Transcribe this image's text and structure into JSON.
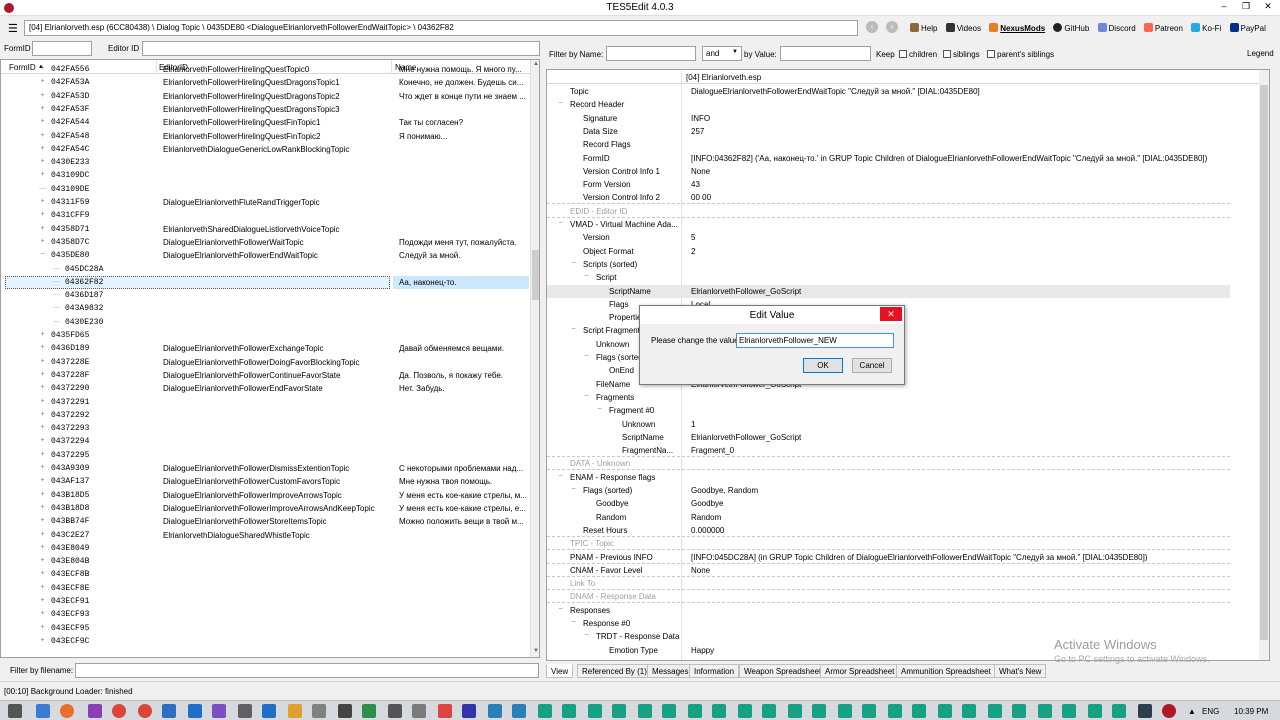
{
  "window": {
    "title": "TES5Edit 4.0.3",
    "minimize": "–",
    "maximize": "❐",
    "close": "✕"
  },
  "toolbar": {
    "path": "[04] Elrianlorveth.esp (6CC80438) \\ Dialog Topic \\ 0435DE80 <DialogueElrianlorvethFollowerEndWaitTopic> \\ 04362F82",
    "links": [
      "Help",
      "Videos",
      "NexusMods",
      "GitHub",
      "Discord",
      "Patreon",
      "Ko-Fi",
      "PayPal"
    ]
  },
  "left_filter": {
    "formid_label": "FormID",
    "editorid_label": "Editor ID"
  },
  "tree": {
    "columns": [
      "FormID",
      "EditorID",
      "Name"
    ],
    "rows": [
      {
        "fid": "042FA556",
        "eid": "ElrianlorvethFollowerHirelingQuestTopic0",
        "name": "Мне нужна помощь. Я много пу...",
        "level": 1,
        "exp": "+"
      },
      {
        "fid": "042FA53A",
        "eid": "ElrianlorvethFollowerHirelingQuestDragonsTopic1",
        "name": "Конечно, не должен. Будешь си...",
        "level": 1,
        "exp": "+"
      },
      {
        "fid": "042FA53D",
        "eid": "ElrianlorvethFollowerHirelingQuestDragonsTopic2",
        "name": "Что ждет в конце пути не знаем ...",
        "level": 1,
        "exp": "+"
      },
      {
        "fid": "042FA53F",
        "eid": "ElrianlorvethFollowerHirelingQuestDragonsTopic3",
        "name": "",
        "level": 1,
        "exp": "+"
      },
      {
        "fid": "042FA544",
        "eid": "ElrianlorvethFollowerHirelingQuestFinTopic1",
        "name": "Так ты согласен?",
        "level": 1,
        "exp": "+"
      },
      {
        "fid": "042FA548",
        "eid": "ElrianlorvethFollowerHirelingQuestFinTopic2",
        "name": "Я понимаю...",
        "level": 1,
        "exp": "+"
      },
      {
        "fid": "042FA54C",
        "eid": "ElrianlorvethDialogueGenericLowRankBlockingTopic",
        "name": "",
        "level": 1,
        "exp": "+"
      },
      {
        "fid": "0430E233",
        "eid": "",
        "name": "",
        "level": 1,
        "exp": "+"
      },
      {
        "fid": "043109DC",
        "eid": "",
        "name": "",
        "level": 1,
        "exp": "+"
      },
      {
        "fid": "043109DE",
        "eid": "",
        "name": "",
        "level": 1,
        "exp": ""
      },
      {
        "fid": "04311F59",
        "eid": "DialogueElrianlorvethFluteRandTriggerTopic",
        "name": "",
        "level": 1,
        "exp": "+"
      },
      {
        "fid": "0431CFF9",
        "eid": "",
        "name": "",
        "level": 1,
        "exp": "+"
      },
      {
        "fid": "04358D71",
        "eid": "ElrianlorvethSharedDialogueListlorvethVoiceTopic",
        "name": "",
        "level": 1,
        "exp": "+"
      },
      {
        "fid": "04358D7C",
        "eid": "DialogueElrianlorvethFollowerWaitTopic",
        "name": "Подожди меня тут, пожалуйста.",
        "level": 1,
        "exp": "+"
      },
      {
        "fid": "0435DE80",
        "eid": "DialogueElrianlorvethFollowerEndWaitTopic",
        "name": "Следуй за мной.",
        "level": 1,
        "exp": "−"
      },
      {
        "fid": "045DC28A",
        "eid": "",
        "name": "",
        "level": 2,
        "exp": ""
      },
      {
        "fid": "04362F82",
        "eid": "",
        "name": "Аа, наконец-то.",
        "level": 2,
        "exp": "",
        "selected": true
      },
      {
        "fid": "0436D187",
        "eid": "",
        "name": "",
        "level": 2,
        "exp": ""
      },
      {
        "fid": "043A9832",
        "eid": "",
        "name": "",
        "level": 2,
        "exp": ""
      },
      {
        "fid": "0430E230",
        "eid": "",
        "name": "",
        "level": 2,
        "exp": ""
      },
      {
        "fid": "0435FD65",
        "eid": "",
        "name": "",
        "level": 1,
        "exp": "+"
      },
      {
        "fid": "0436D189",
        "eid": "DialogueElrianlorvethFollowerExchangeTopic",
        "name": "Давай обменяемся вещами.",
        "level": 1,
        "exp": "+"
      },
      {
        "fid": "0437228E",
        "eid": "DialogueElrianlorvethFollowerDoingFavorBlockingTopic",
        "name": "",
        "level": 1,
        "exp": "+"
      },
      {
        "fid": "0437228F",
        "eid": "DialogueElrianlorvethFollowerContinueFavorState",
        "name": "Да. Позволь, я покажу тебе.",
        "level": 1,
        "exp": "+"
      },
      {
        "fid": "04372290",
        "eid": "DialogueElrianlorvethFollowerEndFavorState",
        "name": "Нет. Забудь.",
        "level": 1,
        "exp": "+"
      },
      {
        "fid": "04372291",
        "eid": "",
        "name": "",
        "level": 1,
        "exp": "+"
      },
      {
        "fid": "04372292",
        "eid": "",
        "name": "",
        "level": 1,
        "exp": "+"
      },
      {
        "fid": "04372293",
        "eid": "",
        "name": "",
        "level": 1,
        "exp": "+"
      },
      {
        "fid": "04372294",
        "eid": "",
        "name": "",
        "level": 1,
        "exp": "+"
      },
      {
        "fid": "04372295",
        "eid": "",
        "name": "",
        "level": 1,
        "exp": "+"
      },
      {
        "fid": "043A9309",
        "eid": "DialogueElrianlorvethFollowerDismissExtentionTopic",
        "name": "С некоторыми проблемами  над...",
        "level": 1,
        "exp": "+"
      },
      {
        "fid": "043AF137",
        "eid": "DialogueElrianlorvethFollowerCustomFavorsTopic",
        "name": "Мне нужна твоя помощь.",
        "level": 1,
        "exp": "+"
      },
      {
        "fid": "043B18D5",
        "eid": "DialogueElrianlorvethFollowerImproveArrowsTopic",
        "name": "У меня есть кое-какие стрелы, м...",
        "level": 1,
        "exp": "+"
      },
      {
        "fid": "043B18D8",
        "eid": "DialogueElrianlorvethFollowerImproveArrowsAndKeepTopic",
        "name": "У меня есть кое-какие стрелы, е...",
        "level": 1,
        "exp": "+"
      },
      {
        "fid": "043BB74F",
        "eid": "DialogueElrianlorvethFollowerStoreItemsTopic",
        "name": "Можно положить вещи в твой м...",
        "level": 1,
        "exp": "+"
      },
      {
        "fid": "043C2E27",
        "eid": "ElrianlorvethDialogueSharedWhistleTopic",
        "name": "",
        "level": 1,
        "exp": "+"
      },
      {
        "fid": "043E8049",
        "eid": "",
        "name": "",
        "level": 1,
        "exp": "+"
      },
      {
        "fid": "043E804B",
        "eid": "",
        "name": "",
        "level": 1,
        "exp": "+"
      },
      {
        "fid": "043ECF8B",
        "eid": "",
        "name": "",
        "level": 1,
        "exp": "+"
      },
      {
        "fid": "043ECF8E",
        "eid": "",
        "name": "",
        "level": 1,
        "exp": "+"
      },
      {
        "fid": "043ECF91",
        "eid": "",
        "name": "",
        "level": 1,
        "exp": "+"
      },
      {
        "fid": "043ECF93",
        "eid": "",
        "name": "",
        "level": 1,
        "exp": "+"
      },
      {
        "fid": "043ECF95",
        "eid": "",
        "name": "",
        "level": 1,
        "exp": "+"
      },
      {
        "fid": "043ECF9C",
        "eid": "",
        "name": "",
        "level": 1,
        "exp": "+"
      }
    ]
  },
  "left_bottom": {
    "filter_label": "Filter by filename:"
  },
  "right_filter": {
    "filter_by_name": "Filter by Name:",
    "and_or": "and",
    "by_value": "by Value:",
    "keep": "Keep",
    "children": "children",
    "siblings": "siblings",
    "parents_siblings": "parent's siblings",
    "legend": "Legend"
  },
  "record": {
    "file_header": "[04] Elrianlorveth.esp",
    "rows": [
      {
        "k": "Topic",
        "v": "DialogueElrianlorvethFollowerEndWaitTopic \"Следуй за мной.\" [DIAL:0435DE80]",
        "level": 0,
        "exp": ""
      },
      {
        "k": "Record Header",
        "v": "",
        "level": 0,
        "exp": "−"
      },
      {
        "k": "Signature",
        "v": "INFO",
        "level": 1,
        "exp": ""
      },
      {
        "k": "Data Size",
        "v": "257",
        "level": 1,
        "exp": ""
      },
      {
        "k": "Record Flags",
        "v": "",
        "level": 1,
        "exp": ""
      },
      {
        "k": "FormID",
        "v": "[INFO:04362F82] ('Аа, наконец-то.' in GRUP Topic Children of DialogueElrianlorvethFollowerEndWaitTopic \"Следуй за мной.\" [DIAL:0435DE80])",
        "level": 1,
        "exp": ""
      },
      {
        "k": "Version Control Info 1",
        "v": "None",
        "level": 1,
        "exp": ""
      },
      {
        "k": "Form Version",
        "v": "43",
        "level": 1,
        "exp": ""
      },
      {
        "k": "Version Control Info 2",
        "v": "00 00",
        "level": 1,
        "exp": "",
        "dashed": true
      },
      {
        "k": "EDID - Editor ID",
        "v": "",
        "level": 0,
        "exp": "",
        "dim": true,
        "dashed": true
      },
      {
        "k": "VMAD - Virtual Machine Ada...",
        "v": "",
        "level": 0,
        "exp": "−"
      },
      {
        "k": "Version",
        "v": "5",
        "level": 1,
        "exp": ""
      },
      {
        "k": "Object Format",
        "v": "2",
        "level": 1,
        "exp": ""
      },
      {
        "k": "Scripts (sorted)",
        "v": "",
        "level": 1,
        "exp": "−"
      },
      {
        "k": "Script",
        "v": "",
        "level": 2,
        "exp": "−"
      },
      {
        "k": "ScriptName",
        "v": "ElrianlorvethFollower_GoScript",
        "level": 3,
        "exp": "",
        "hl": true
      },
      {
        "k": "Flags",
        "v": "Local",
        "level": 3,
        "exp": ""
      },
      {
        "k": "Properties",
        "v": "",
        "level": 3,
        "exp": ""
      },
      {
        "k": "Script Fragments",
        "v": "",
        "level": 1,
        "exp": "−"
      },
      {
        "k": "Unknown",
        "v": "",
        "level": 2,
        "exp": ""
      },
      {
        "k": "Flags (sorted)",
        "v": "",
        "level": 2,
        "exp": "−"
      },
      {
        "k": "OnEnd",
        "v": "",
        "level": 3,
        "exp": ""
      },
      {
        "k": "FileName",
        "v": "ElrianlorvethFollower_GoScript",
        "level": 2,
        "exp": ""
      },
      {
        "k": "Fragments",
        "v": "",
        "level": 2,
        "exp": "−"
      },
      {
        "k": "Fragment #0",
        "v": "",
        "level": 3,
        "exp": "−"
      },
      {
        "k": "Unknown",
        "v": "1",
        "level": 4,
        "exp": ""
      },
      {
        "k": "ScriptName",
        "v": "ElrianlorvethFollower_GoScript",
        "level": 4,
        "exp": ""
      },
      {
        "k": "FragmentNa...",
        "v": "Fragment_0",
        "level": 4,
        "exp": "",
        "dashed": true
      },
      {
        "k": "DATA - Unknown",
        "v": "",
        "level": 0,
        "exp": "",
        "dim": true,
        "dashed": true
      },
      {
        "k": "ENAM - Response flags",
        "v": "",
        "level": 0,
        "exp": "−"
      },
      {
        "k": "Flags (sorted)",
        "v": "Goodbye, Random",
        "level": 1,
        "exp": "−"
      },
      {
        "k": "Goodbye",
        "v": "Goodbye",
        "level": 2,
        "exp": ""
      },
      {
        "k": "Random",
        "v": "Random",
        "level": 2,
        "exp": ""
      },
      {
        "k": "Reset Hours",
        "v": "0.000000",
        "level": 1,
        "exp": "",
        "dashed": true
      },
      {
        "k": "TPIC - Topic",
        "v": "",
        "level": 0,
        "exp": "",
        "dim": true,
        "dashed": true
      },
      {
        "k": "PNAM - Previous INFO",
        "v": "[INFO:045DC28A] (in GRUP Topic Children of DialogueElrianlorvethFollowerEndWaitTopic \"Следуй за мной.\" [DIAL:0435DE80])",
        "level": 0,
        "exp": "",
        "dashed": true
      },
      {
        "k": "CNAM - Favor Level",
        "v": "None",
        "level": 0,
        "exp": "",
        "dashed": true
      },
      {
        "k": "Link To",
        "v": "",
        "level": 0,
        "exp": "",
        "dim": true,
        "dashed": true
      },
      {
        "k": "DNAM - Response Data",
        "v": "",
        "level": 0,
        "exp": "",
        "dim": true,
        "dashed": true
      },
      {
        "k": "Responses",
        "v": "",
        "level": 0,
        "exp": "−"
      },
      {
        "k": "Response #0",
        "v": "",
        "level": 1,
        "exp": "−"
      },
      {
        "k": "TRDT - Response Data",
        "v": "",
        "level": 2,
        "exp": "−"
      },
      {
        "k": "Emotion Type",
        "v": "Happy",
        "level": 3,
        "exp": ""
      }
    ]
  },
  "tabs": [
    "View",
    "Referenced By (1)",
    "Messages",
    "Information",
    "Weapon Spreadsheet",
    "Armor Spreadsheet",
    "Ammunition Spreadsheet",
    "What's New"
  ],
  "dialog": {
    "title": "Edit Value",
    "label": "Please change the value:",
    "value": "ElrianlorvethFollower_NEW",
    "ok": "OK",
    "cancel": "Cancel"
  },
  "watermark": {
    "line1": "Activate Windows",
    "line2": "Go to PC settings to activate Windows."
  },
  "status": "[00:10] Background Loader: finished",
  "taskbar": {
    "lang": "ENG",
    "time": "10:39 PM"
  }
}
